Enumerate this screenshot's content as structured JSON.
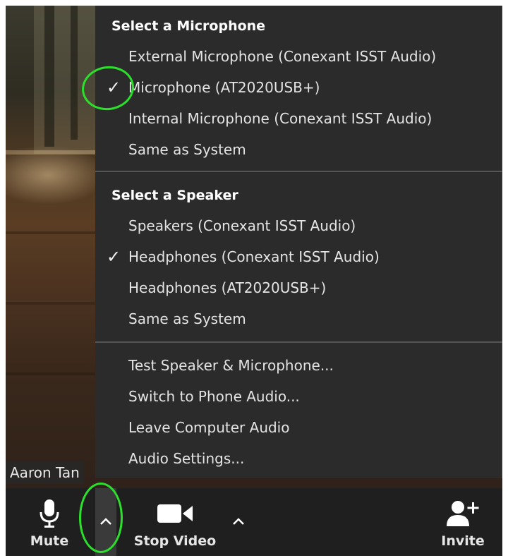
{
  "participant": {
    "name": "Aaron Tan"
  },
  "menu": {
    "microphone_section": {
      "header": "Select a Microphone",
      "items": [
        {
          "label": "External Microphone (Conexant ISST Audio)",
          "selected": false
        },
        {
          "label": "Microphone (AT2020USB+)",
          "selected": true
        },
        {
          "label": "Internal Microphone (Conexant ISST Audio)",
          "selected": false
        },
        {
          "label": "Same as System",
          "selected": false
        }
      ]
    },
    "speaker_section": {
      "header": "Select a Speaker",
      "items": [
        {
          "label": "Speakers (Conexant ISST Audio)",
          "selected": false
        },
        {
          "label": "Headphones (Conexant ISST Audio)",
          "selected": true
        },
        {
          "label": "Headphones (AT2020USB+)",
          "selected": false
        },
        {
          "label": "Same as System",
          "selected": false
        }
      ]
    },
    "actions": [
      {
        "label": "Test Speaker & Microphone..."
      },
      {
        "label": "Switch to Phone Audio..."
      },
      {
        "label": "Leave Computer Audio"
      },
      {
        "label": "Audio Settings..."
      }
    ],
    "check_glyph": "✓"
  },
  "toolbar": {
    "mute_label": "Mute",
    "stop_video_label": "Stop Video",
    "invite_label": "Invite"
  },
  "icons": {
    "microphone": "microphone-icon",
    "video_camera": "video-camera-icon",
    "chevron_up": "chevron-up-icon",
    "add_user": "add-user-icon"
  },
  "colors": {
    "menu_bg": "#2b2b2b",
    "toolbar_bg": "#1f1f1f",
    "annotation": "#2be02b"
  }
}
